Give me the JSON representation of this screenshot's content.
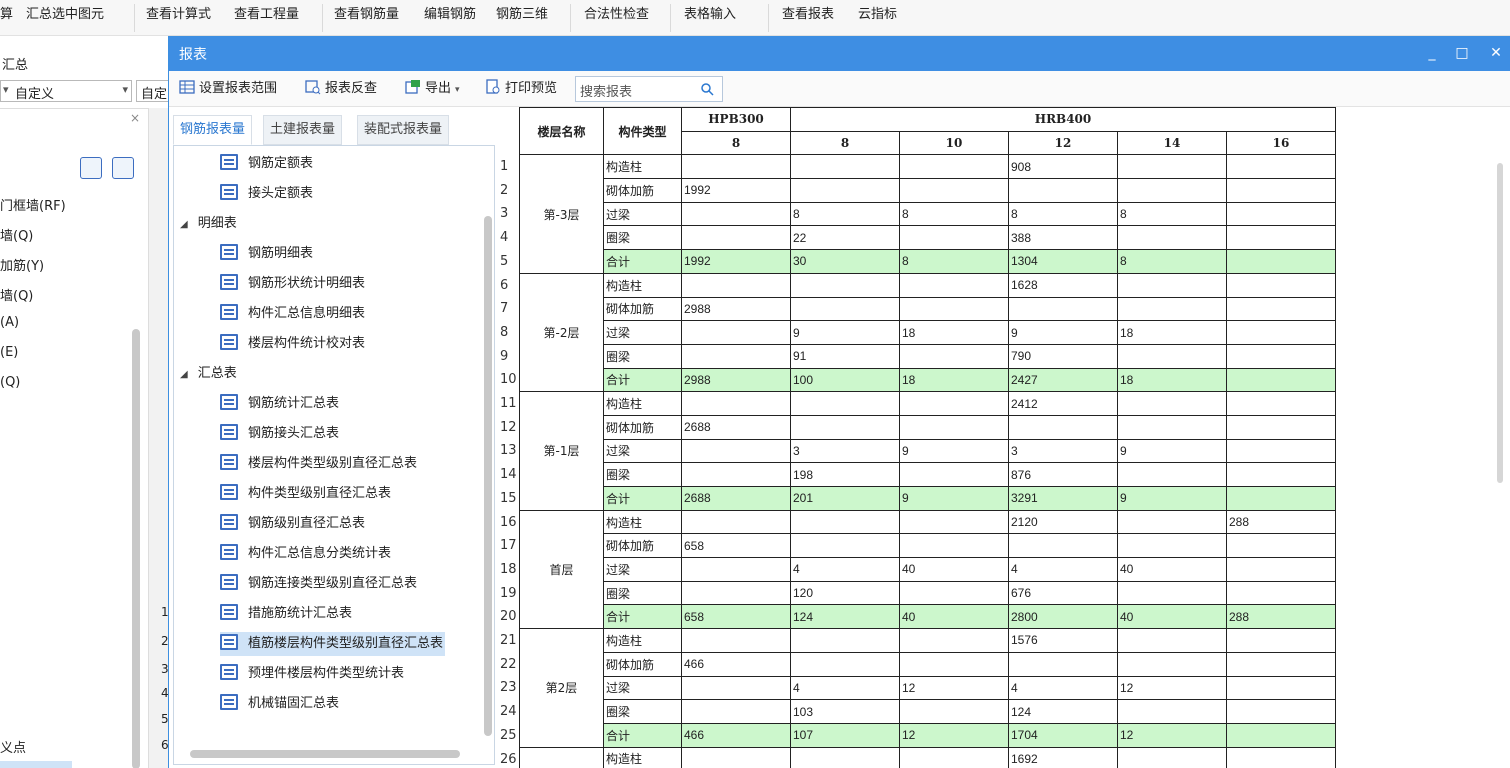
{
  "ribbon": {
    "items": [
      "算",
      "汇总选中图元",
      "查看计算式",
      "查看工程量",
      "查看钢筋量",
      "编辑钢筋",
      "钢筋三维",
      "合法性检查",
      "表格输入",
      "查看报表",
      "云指标"
    ]
  },
  "background": {
    "label_summary": "汇总",
    "select1": "自定义",
    "select2": "自定",
    "list_items": [
      "门框墙(RF)",
      "墙(Q)",
      "加筋(Y)",
      "墙(Q)",
      "(A)",
      "(E)",
      "(Q)"
    ],
    "row_numbers": [
      "1",
      "2",
      "3",
      "4",
      "5",
      "6"
    ],
    "bottom_label": "义点"
  },
  "window": {
    "title": "报表",
    "minimize": "_",
    "maximize": "□",
    "close": "✕"
  },
  "toolbar": {
    "set_range": "设置报表范围",
    "reverse_check": "报表反查",
    "export": "导出",
    "print_preview": "打印预览",
    "search_placeholder": "搜索报表"
  },
  "tabs": [
    "钢筋报表量",
    "土建报表量",
    "装配式报表量"
  ],
  "tree": {
    "items_top": [
      "钢筋定额表",
      "接头定额表"
    ],
    "group_detail": "明细表",
    "detail_items": [
      "钢筋明细表",
      "钢筋形状统计明细表",
      "构件汇总信息明细表",
      "楼层构件统计校对表"
    ],
    "group_summary": "汇总表",
    "summary_items": [
      "钢筋统计汇总表",
      "钢筋接头汇总表",
      "楼层构件类型级别直径汇总表",
      "构件类型级别直径汇总表",
      "钢筋级别直径汇总表",
      "构件汇总信息分类统计表",
      "钢筋连接类型级别直径汇总表",
      "措施筋统计汇总表",
      "植筋楼层构件类型级别直径汇总表",
      "预埋件楼层构件类型统计表",
      "机械锚固汇总表"
    ],
    "selected": "植筋楼层构件类型级别直径汇总表"
  },
  "report": {
    "header_floor": "楼层名称",
    "header_type": "构件类型",
    "grade1": "HPB300",
    "grade2": "HRB400",
    "diameters": [
      "8",
      "8",
      "10",
      "12",
      "14",
      "16"
    ],
    "row_numbers": [
      "1",
      "2",
      "3",
      "4",
      "5",
      "6",
      "7",
      "8",
      "9",
      "10",
      "11",
      "12",
      "13",
      "14",
      "15",
      "16",
      "17",
      "18",
      "19",
      "20",
      "21",
      "22",
      "23",
      "24",
      "25",
      "26"
    ],
    "floors": [
      {
        "name": "第-3层",
        "rows": [
          {
            "type": "构造柱",
            "v": [
              "",
              "",
              "",
              "908",
              "",
              ""
            ]
          },
          {
            "type": "砌体加筋",
            "v": [
              "1992",
              "",
              "",
              "",
              "",
              ""
            ]
          },
          {
            "type": "过梁",
            "v": [
              "",
              "8",
              "8",
              "8",
              "8",
              ""
            ]
          },
          {
            "type": "圈梁",
            "v": [
              "",
              "22",
              "",
              "388",
              "",
              ""
            ]
          },
          {
            "type": "合计",
            "v": [
              "1992",
              "30",
              "8",
              "1304",
              "8",
              ""
            ],
            "total": true
          }
        ]
      },
      {
        "name": "第-2层",
        "rows": [
          {
            "type": "构造柱",
            "v": [
              "",
              "",
              "",
              "1628",
              "",
              ""
            ]
          },
          {
            "type": "砌体加筋",
            "v": [
              "2988",
              "",
              "",
              "",
              "",
              ""
            ]
          },
          {
            "type": "过梁",
            "v": [
              "",
              "9",
              "18",
              "9",
              "18",
              ""
            ]
          },
          {
            "type": "圈梁",
            "v": [
              "",
              "91",
              "",
              "790",
              "",
              ""
            ]
          },
          {
            "type": "合计",
            "v": [
              "2988",
              "100",
              "18",
              "2427",
              "18",
              ""
            ],
            "total": true
          }
        ]
      },
      {
        "name": "第-1层",
        "rows": [
          {
            "type": "构造柱",
            "v": [
              "",
              "",
              "",
              "2412",
              "",
              ""
            ]
          },
          {
            "type": "砌体加筋",
            "v": [
              "2688",
              "",
              "",
              "",
              "",
              ""
            ]
          },
          {
            "type": "过梁",
            "v": [
              "",
              "3",
              "9",
              "3",
              "9",
              ""
            ]
          },
          {
            "type": "圈梁",
            "v": [
              "",
              "198",
              "",
              "876",
              "",
              ""
            ]
          },
          {
            "type": "合计",
            "v": [
              "2688",
              "201",
              "9",
              "3291",
              "9",
              ""
            ],
            "total": true
          }
        ]
      },
      {
        "name": "首层",
        "rows": [
          {
            "type": "构造柱",
            "v": [
              "",
              "",
              "",
              "2120",
              "",
              "288"
            ]
          },
          {
            "type": "砌体加筋",
            "v": [
              "658",
              "",
              "",
              "",
              "",
              ""
            ]
          },
          {
            "type": "过梁",
            "v": [
              "",
              "4",
              "40",
              "4",
              "40",
              ""
            ]
          },
          {
            "type": "圈梁",
            "v": [
              "",
              "120",
              "",
              "676",
              "",
              ""
            ]
          },
          {
            "type": "合计",
            "v": [
              "658",
              "124",
              "40",
              "2800",
              "40",
              "288"
            ],
            "total": true
          }
        ]
      },
      {
        "name": "第2层",
        "rows": [
          {
            "type": "构造柱",
            "v": [
              "",
              "",
              "",
              "1576",
              "",
              ""
            ]
          },
          {
            "type": "砌体加筋",
            "v": [
              "466",
              "",
              "",
              "",
              "",
              ""
            ]
          },
          {
            "type": "过梁",
            "v": [
              "",
              "4",
              "12",
              "4",
              "12",
              ""
            ]
          },
          {
            "type": "圈梁",
            "v": [
              "",
              "103",
              "",
              "124",
              "",
              ""
            ]
          },
          {
            "type": "合计",
            "v": [
              "466",
              "107",
              "12",
              "1704",
              "12",
              ""
            ],
            "total": true
          }
        ]
      },
      {
        "name": "",
        "rows": [
          {
            "type": "构造柱",
            "v": [
              "",
              "",
              "",
              "1692",
              "",
              ""
            ]
          }
        ]
      }
    ]
  },
  "colors": {
    "title_bar": "#3e8ee3",
    "total_row": "#ccf7cc",
    "selected_item": "#cfe3f7",
    "active_tab": "#2b78d0"
  }
}
